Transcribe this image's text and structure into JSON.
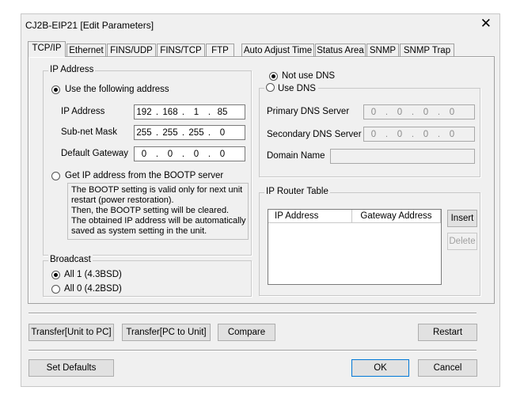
{
  "window": {
    "title": "CJ2B-EIP21 [Edit Parameters]",
    "close_glyph": "✕"
  },
  "tabs": [
    "TCP/IP",
    "Ethernet",
    "FINS/UDP",
    "FINS/TCP",
    "FTP",
    "Auto Adjust Time",
    "Status Area",
    "SNMP",
    "SNMP Trap"
  ],
  "ip": {
    "group_label": "IP Address",
    "use_following_label": "Use the following address",
    "ip_label": "IP Address",
    "ip_value": [
      "192",
      "168",
      "1",
      "85"
    ],
    "mask_label": "Sub-net Mask",
    "mask_value": [
      "255",
      "255",
      "255",
      "0"
    ],
    "gateway_label": "Default Gateway",
    "gateway_value": [
      "0",
      "0",
      "0",
      "0"
    ],
    "bootp_label": "Get IP address from the BOOTP server",
    "bootp_note": [
      "The BOOTP setting is valid only for next unit",
      "restart (power restoration).",
      "Then, the BOOTP setting will be cleared.",
      "The obtained IP address will be automatically",
      "saved as system setting in the unit."
    ]
  },
  "broadcast": {
    "group_label": "Broadcast",
    "all1_label": "All 1 (4.3BSD)",
    "all0_label": "All 0 (4.2BSD)"
  },
  "dns": {
    "not_use_label": "Not use DNS",
    "use_label": "Use DNS",
    "primary_label": "Primary DNS Server",
    "primary_value": [
      "0",
      "0",
      "0",
      "0"
    ],
    "secondary_label": "Secondary DNS Server",
    "secondary_value": [
      "0",
      "0",
      "0",
      "0"
    ],
    "domain_label": "Domain Name"
  },
  "router": {
    "group_label": "IP Router Table",
    "col_ip": "IP Address",
    "col_gateway": "Gateway Address",
    "insert_label": "Insert",
    "delete_label": "Delete"
  },
  "buttons": {
    "transfer_to_pc": "Transfer[Unit to PC]",
    "transfer_to_unit": "Transfer[PC to Unit]",
    "compare": "Compare",
    "restart": "Restart",
    "set_defaults": "Set Defaults",
    "ok": "OK",
    "cancel": "Cancel"
  }
}
